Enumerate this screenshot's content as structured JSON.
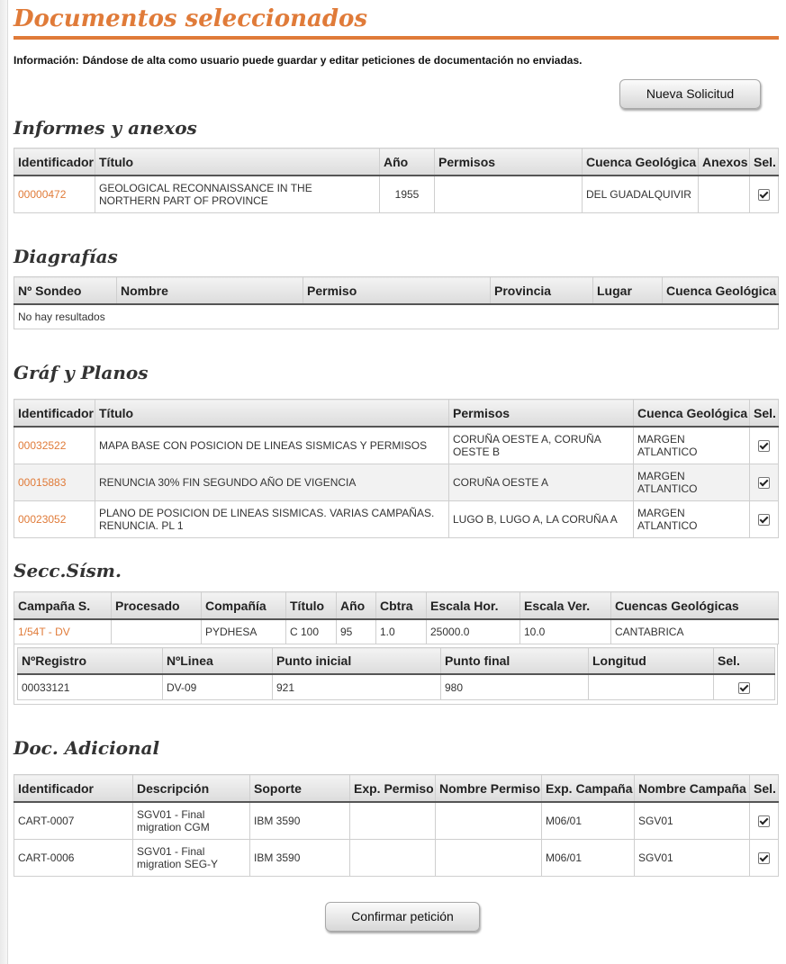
{
  "page": {
    "title": "Documentos seleccionados",
    "info_label": "Información:",
    "info_text": "Dándose de alta como usuario puede guardar y editar peticiones de documentación no enviadas.",
    "new_request_button": "Nueva Solicitud",
    "confirm_button": "Confirmar petición",
    "accent_color": "#e07b39"
  },
  "informes": {
    "title": "Informes y anexos",
    "headers": [
      "Identificador",
      "Título",
      "Año",
      "Permisos",
      "Cuenca Geológica",
      "Anexos",
      "Sel."
    ],
    "rows": [
      {
        "id": "00000472",
        "titulo": "GEOLOGICAL RECONNAISSANCE IN THE NORTHERN PART OF PROVINCE",
        "anio": "1955",
        "permisos": "",
        "cuenca": "DEL GUADALQUIVIR",
        "anexos": "",
        "sel": true
      }
    ]
  },
  "diagrafias": {
    "title": "Diagrafías",
    "headers": [
      "Nº Sondeo",
      "Nombre",
      "Permiso",
      "Provincia",
      "Lugar",
      "Cuenca Geológica"
    ],
    "empty_text": "No hay resultados"
  },
  "graf": {
    "title": "Gráf y Planos",
    "headers": [
      "Identificador",
      "Título",
      "Permisos",
      "Cuenca Geológica",
      "Sel."
    ],
    "rows": [
      {
        "id": "00032522",
        "titulo": "MAPA BASE CON POSICION DE LINEAS SISMICAS Y PERMISOS",
        "permisos": "CORUÑA OESTE A, CORUÑA OESTE B",
        "cuenca": "MARGEN ATLANTICO",
        "sel": true
      },
      {
        "id": "00015883",
        "titulo": "RENUNCIA 30% FIN SEGUNDO AÑO DE VIGENCIA",
        "permisos": "CORUÑA OESTE A",
        "cuenca": "MARGEN ATLANTICO",
        "sel": true
      },
      {
        "id": "00023052",
        "titulo": "PLANO DE POSICION DE LINEAS SISMICAS. VARIAS CAMPAÑAS. RENUNCIA. PL 1",
        "permisos": "LUGO B, LUGO A, LA CORUÑA A",
        "cuenca": "MARGEN ATLANTICO",
        "sel": true
      }
    ]
  },
  "secc": {
    "title": "Secc.Sísm.",
    "headers": [
      "Campaña S.",
      "Procesado",
      "Compañía",
      "Título",
      "Año",
      "Cbtra",
      "Escala Hor.",
      "Escala Ver.",
      "Cuencas Geológicas"
    ],
    "row": {
      "campana": "1/54T - DV",
      "procesado": "",
      "compania": "PYDHESA",
      "titulo": "C 100",
      "anio": "95",
      "cbtra": "1.0",
      "escala_hor": "25000.0",
      "escala_ver": "10.0",
      "cuencas": "CANTABRICA"
    },
    "inner_headers": [
      "NºRegistro",
      "NºLinea",
      "Punto inicial",
      "Punto final",
      "Longitud",
      "Sel."
    ],
    "inner_row": {
      "registro": "00033121",
      "linea": "DV-09",
      "punto_inicial": "921",
      "punto_final": "980",
      "longitud": "",
      "sel": true
    }
  },
  "doc": {
    "title": "Doc. Adicional",
    "headers": [
      "Identificador",
      "Descripción",
      "Soporte",
      "Exp. Permiso",
      "Nombre Permiso",
      "Exp. Campaña",
      "Nombre Campaña",
      "Sel."
    ],
    "rows": [
      {
        "id": "CART-0007",
        "descripcion": "SGV01 - Final migration CGM",
        "soporte": "IBM 3590",
        "exp_permiso": "",
        "nombre_permiso": "",
        "exp_campana": "M06/01",
        "nombre_campana": "SGV01",
        "sel": true
      },
      {
        "id": "CART-0006",
        "descripcion": "SGV01 - Final migration SEG-Y",
        "soporte": "IBM 3590",
        "exp_permiso": "",
        "nombre_permiso": "",
        "exp_campana": "M06/01",
        "nombre_campana": "SGV01",
        "sel": true
      }
    ]
  }
}
